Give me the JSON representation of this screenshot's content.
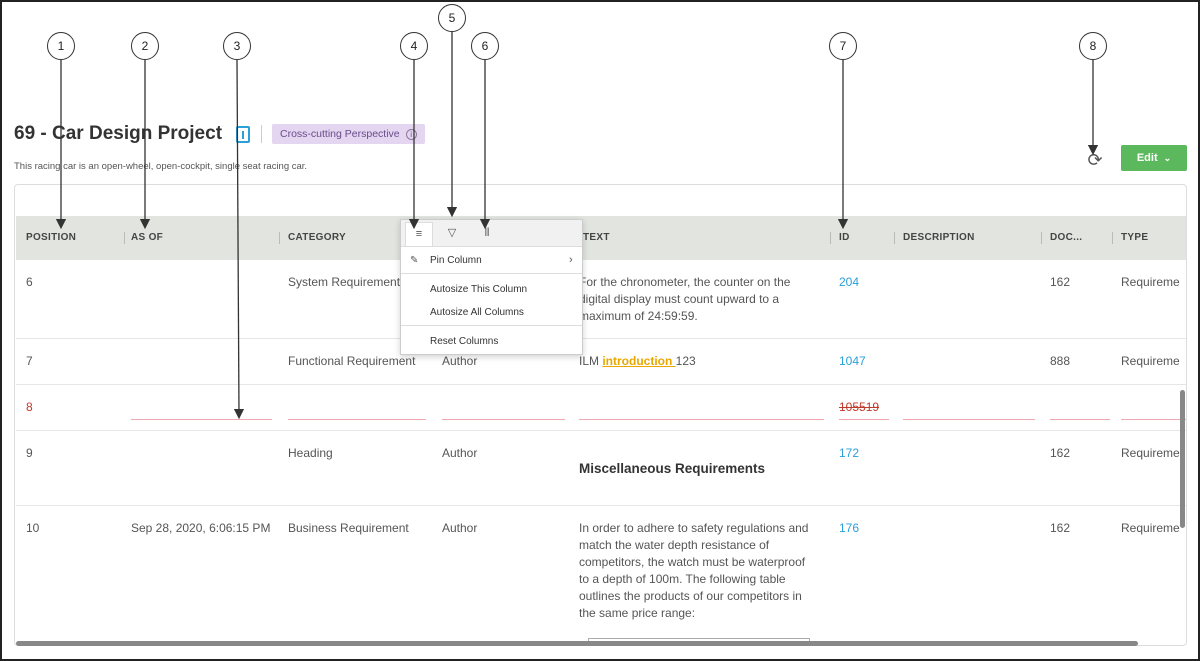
{
  "callouts": [
    "1",
    "2",
    "3",
    "4",
    "5",
    "6",
    "7",
    "8"
  ],
  "header": {
    "title": "69 - Car Design Project",
    "badge": "Cross-cutting Perspective",
    "badge_info": "i",
    "subtitle": "This racing car is an open-wheel, open-cockpit, single seat racing car.",
    "edit_label": "Edit",
    "refresh_glyph": "⟳",
    "edit_chevron": "⌄"
  },
  "columns": [
    "POSITION",
    "AS OF",
    "CATEGORY",
    "TEXT",
    "ID",
    "DESCRIPTION",
    "DOC...",
    "TYPE"
  ],
  "column_menu": {
    "tab_menu_icon": "≡",
    "tab_filter_icon": "▽",
    "tab_columns_icon": "⦀",
    "pin_icon": "✎",
    "pin_column": "Pin Column",
    "submenu_arrow": "›",
    "autosize_this": "Autosize This Column",
    "autosize_all": "Autosize All Columns",
    "reset_columns": "Reset Columns"
  },
  "rows": [
    {
      "position": "6",
      "as_of": "",
      "category": "System Requirement",
      "author": "",
      "text_lines": [
        "For the chronometer, the counter on the",
        "digital display must count upward to a",
        "maximum of 24:59:59."
      ],
      "id": "204",
      "doc": "162",
      "type": "Requireme"
    },
    {
      "position": "7",
      "as_of": "",
      "category": "Functional Requirement",
      "author": "Author",
      "text_pre": "ILM ",
      "text_hl": "introduction ",
      "text_post": "123",
      "id": "1047",
      "doc": "888",
      "type": "Requireme"
    },
    {
      "position": "8",
      "id": "105519",
      "deleted": true
    },
    {
      "position": "9",
      "as_of": "",
      "category": "Heading",
      "author": "Author",
      "heading": "Miscellaneous Requirements",
      "id": "172",
      "doc": "162",
      "type": "Requireme"
    },
    {
      "position": "10",
      "as_of": "Sep 28, 2020, 6:06:15 PM",
      "category": "Business Requirement",
      "author": "Author",
      "text_lines": [
        "In order to adhere to safety regulations and",
        "match the water depth resistance of",
        "competitors, the watch must be waterproof",
        "to a depth of 100m. The following table",
        "outlines the products of our competitors in",
        "the same price range:"
      ],
      "id": "176",
      "doc": "162",
      "type": "Requireme"
    }
  ],
  "colors": {
    "accent": "#2a9fd8",
    "edit": "#5cb85c",
    "badge_bg": "#e4d5f0",
    "header_bg": "#e2e5df",
    "deleted": "#c0392b"
  }
}
